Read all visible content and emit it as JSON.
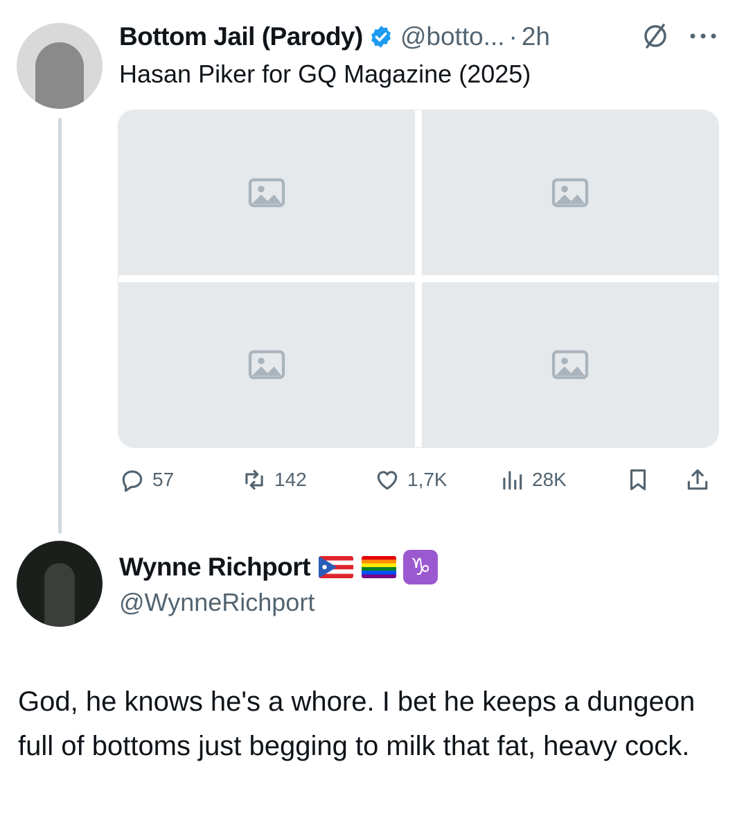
{
  "original_tweet": {
    "author_name": "Bottom Jail (Parody)",
    "handle": "@botto...",
    "separator": "·",
    "time": "2h",
    "verified": true,
    "text": "Hasan Piker for GQ Magazine (2025)",
    "icons": {
      "verified": "verified-badge-icon",
      "grok": "grok-icon",
      "more": "more-options-icon"
    },
    "media": [
      {
        "name": "media-photo-1"
      },
      {
        "name": "media-photo-2"
      },
      {
        "name": "media-photo-3"
      },
      {
        "name": "media-photo-4"
      }
    ],
    "actions": {
      "replies": "57",
      "retweets": "142",
      "likes": "1,7K",
      "views": "28K"
    }
  },
  "reply_tweet": {
    "author_name": "Wynne Richport",
    "handle": "@WynneRichport",
    "name_emojis": [
      "puerto-rico-flag-icon",
      "rainbow-flag-icon",
      "capricorn-icon"
    ],
    "capricorn_symbol": "♑",
    "text": "God, he knows he's a whore. I bet he keeps a dungeon full of bottoms just begging to milk that fat, heavy cock."
  },
  "colors": {
    "accent": "#1d9bf0",
    "secondary_text": "#536471",
    "thread_line": "#cfd9de",
    "capricorn_bg": "#9b59d0"
  }
}
